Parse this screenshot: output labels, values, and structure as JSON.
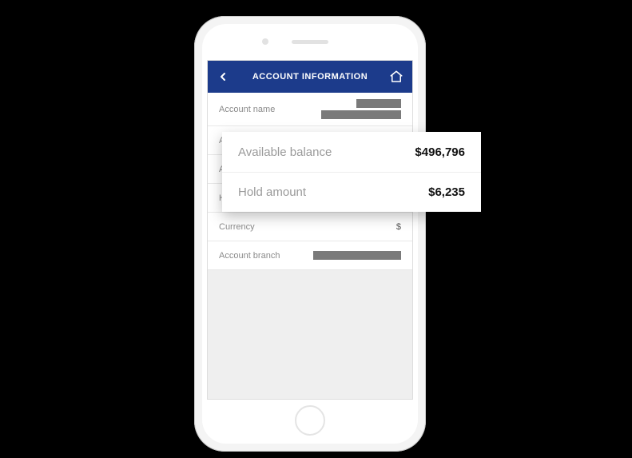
{
  "header": {
    "title": "ACCOUNT INFORMATION"
  },
  "rows": {
    "account_name": {
      "label": "Account name"
    },
    "account_number": {
      "label": "Account number"
    },
    "available_balance": {
      "label": "Available balance",
      "value": "$496,796"
    },
    "hold_amount": {
      "label": "Hold amount",
      "value": "$6,235"
    },
    "currency": {
      "label": "Currency",
      "value": "$"
    },
    "account_branch": {
      "label": "Account branch"
    }
  },
  "callout": {
    "available_balance": {
      "label": "Available balance",
      "value": "$496,796"
    },
    "hold_amount": {
      "label": "Hold amount",
      "value": "$6,235"
    }
  },
  "colors": {
    "header_bg": "#1c3b8b"
  }
}
